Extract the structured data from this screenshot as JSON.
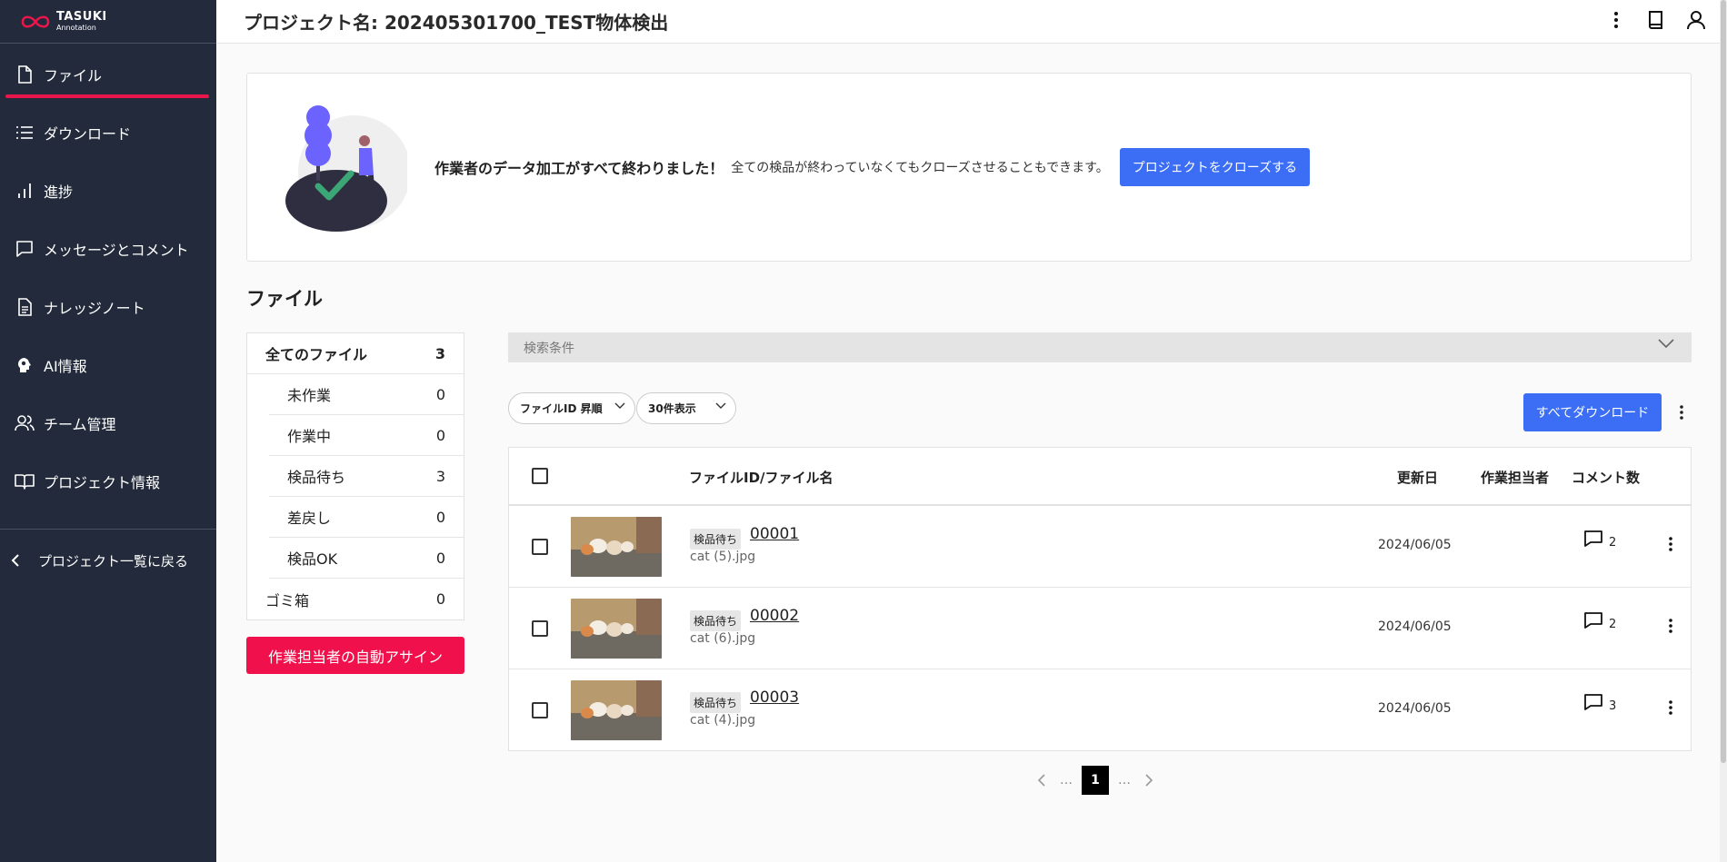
{
  "brand": {
    "name": "TASUKI",
    "sub": "Annotation",
    "color": "#e8164b"
  },
  "sidebar": {
    "items": [
      {
        "label": "ファイル",
        "icon": "file-icon",
        "active": true
      },
      {
        "label": "ダウンロード",
        "icon": "list-icon"
      },
      {
        "label": "進捗",
        "icon": "bar-chart-icon"
      },
      {
        "label": "メッセージとコメント",
        "icon": "message-icon"
      },
      {
        "label": "ナレッジノート",
        "icon": "document-icon"
      },
      {
        "label": "AI情報",
        "icon": "ai-head-icon"
      },
      {
        "label": "チーム管理",
        "icon": "team-icon"
      },
      {
        "label": "プロジェクト情報",
        "icon": "book-icon"
      }
    ],
    "back_label": "プロジェクト一覧に戻る"
  },
  "header": {
    "title": "プロジェクト名: 202405301700_TEST物体検出",
    "icons": [
      "more-vertical-icon",
      "book-icon",
      "user-icon"
    ]
  },
  "banner": {
    "strong": "作業者のデータ加工がすべて終わりました！",
    "sub": "全ての検品が終わっていなくてもクローズさせることもできます。",
    "button": "プロジェクトをクローズする",
    "accent": "#3b6ef5"
  },
  "section_title": "ファイル",
  "filters": [
    {
      "label": "全てのファイル",
      "count": "3",
      "level": "top"
    },
    {
      "label": "未作業",
      "count": "0",
      "level": "sub"
    },
    {
      "label": "作業中",
      "count": "0",
      "level": "sub"
    },
    {
      "label": "検品待ち",
      "count": "3",
      "level": "sub"
    },
    {
      "label": "差戻し",
      "count": "0",
      "level": "sub"
    },
    {
      "label": "検品OK",
      "count": "0",
      "level": "sub"
    },
    {
      "label": "ゴミ箱",
      "count": "0",
      "level": "top"
    }
  ],
  "auto_assign_button": "作業担当者の自動アサイン",
  "search": {
    "label": "検索条件"
  },
  "sort_select": {
    "value": "ファイルID 昇順"
  },
  "per_page_select": {
    "value": "30件表示"
  },
  "download_all_button": "すべてダウンロード",
  "table": {
    "headers": {
      "file": "ファイルID/ファイル名",
      "updated": "更新日",
      "assignee": "作業担当者",
      "comments": "コメント数"
    },
    "rows": [
      {
        "status": "検品待ち",
        "id": "00001",
        "name": "cat (5).jpg",
        "date": "2024/06/05",
        "assignee": "",
        "comments": "2"
      },
      {
        "status": "検品待ち",
        "id": "00002",
        "name": "cat (6).jpg",
        "date": "2024/06/05",
        "assignee": "",
        "comments": "2"
      },
      {
        "status": "検品待ち",
        "id": "00003",
        "name": "cat (4).jpg",
        "date": "2024/06/05",
        "assignee": "",
        "comments": "3"
      }
    ]
  },
  "pagination": {
    "current": "1",
    "ellipsis": "…"
  }
}
